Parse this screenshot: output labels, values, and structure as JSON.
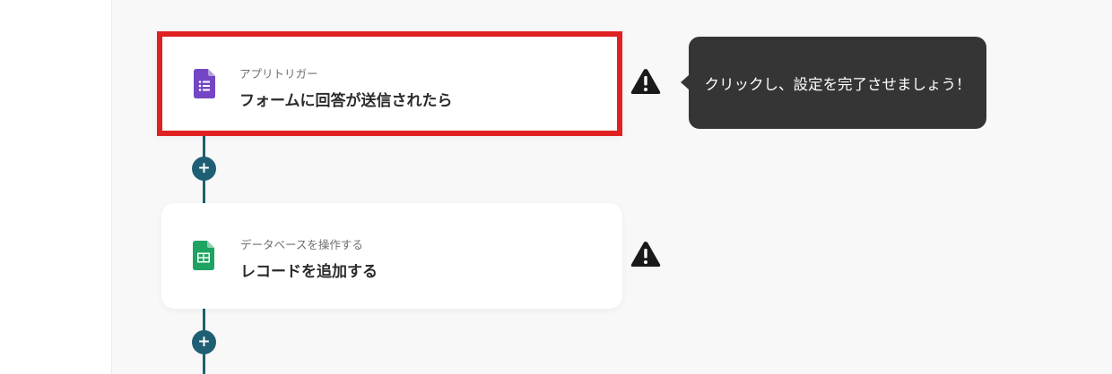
{
  "flow": {
    "steps": [
      {
        "subtitle": "アプリトリガー",
        "title": "フォームに回答が送信されたら",
        "icon": "google-forms-icon",
        "status_icon": "warning-icon",
        "highlighted": true
      },
      {
        "subtitle": "データベースを操作する",
        "title": "レコードを追加する",
        "icon": "google-sheets-icon",
        "status_icon": "warning-icon",
        "highlighted": false
      }
    ],
    "add_step_icon": "+"
  },
  "tooltip": {
    "text": "クリックし、設定を完了させましょう！"
  },
  "colors": {
    "highlight_border": "#e02121",
    "connector": "#1f5f73",
    "tooltip_bg": "#353535",
    "forms_purple": "#7446c5",
    "sheets_green": "#1ea362"
  }
}
